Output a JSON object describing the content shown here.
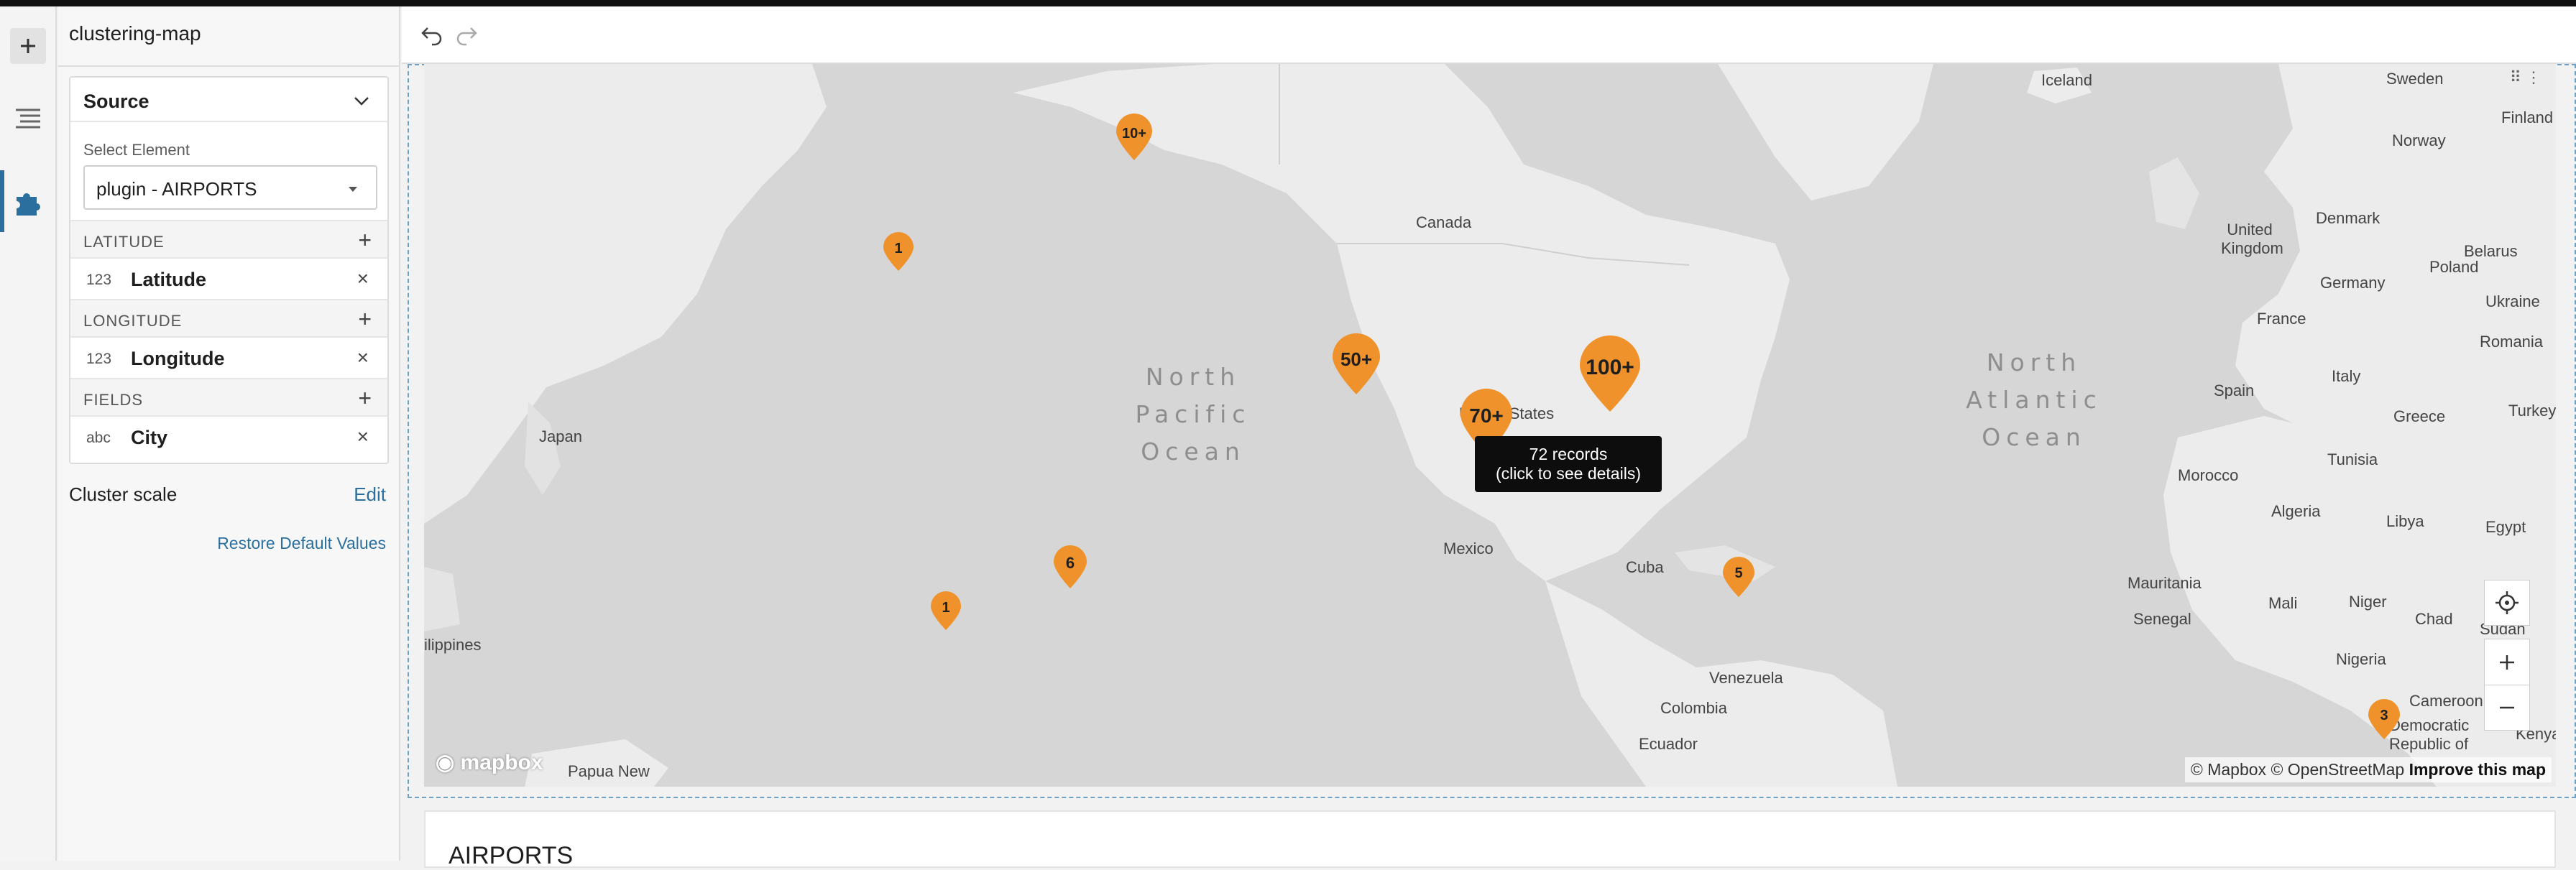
{
  "panel": {
    "title": "clustering-map",
    "source": {
      "title": "Source",
      "select_label": "Select Element",
      "select_value": "plugin - AIRPORTS"
    },
    "sections": [
      {
        "label": "LATITUDE",
        "field": {
          "type": "123",
          "name": "Latitude"
        }
      },
      {
        "label": "LONGITUDE",
        "field": {
          "type": "123",
          "name": "Longitude"
        }
      },
      {
        "label": "FIELDS",
        "field": {
          "type": "abc",
          "name": "City"
        }
      }
    ],
    "cluster_scale_label": "Cluster scale",
    "cluster_scale_edit": "Edit",
    "restore_label": "Restore Default Values"
  },
  "map": {
    "oceans": [
      {
        "text": "North Pacific Ocean"
      },
      {
        "text": "North Atlantic Ocean"
      }
    ],
    "places": [
      "Iceland",
      "Sweden",
      "Finland",
      "Norway",
      "Canada",
      "United Kingdom",
      "Denmark",
      "Belarus",
      "Poland",
      "Germany",
      "Ukraine",
      "France",
      "Romania",
      "Spain",
      "Italy",
      "Greece",
      "Turkey",
      "Japan",
      "United States",
      "Tunisia",
      "Morocco",
      "Algeria",
      "Libya",
      "Egypt",
      "Mexico",
      "Cuba",
      "Mauritania",
      "Mali",
      "Niger",
      "Chad",
      "Sudan",
      "Senegal",
      "Nigeria",
      "Venezuela",
      "Colombia",
      "Ecuador",
      "Cameroon",
      "Democratic Republic of",
      "Kenya",
      "Papua New",
      "ilippines"
    ],
    "clusters": [
      {
        "label": "10+",
        "count_bucket": "10+"
      },
      {
        "label": "1",
        "count_bucket": "1"
      },
      {
        "label": "50+",
        "count_bucket": "50+"
      },
      {
        "label": "100+",
        "count_bucket": "100+"
      },
      {
        "label": "70+",
        "count_bucket": "70+"
      },
      {
        "label": "6",
        "count_bucket": "6"
      },
      {
        "label": "1",
        "count_bucket": "1"
      },
      {
        "label": "5",
        "count_bucket": "5"
      },
      {
        "label": "3",
        "count_bucket": "3"
      }
    ],
    "tooltip": {
      "line1": "72 records",
      "line2": "(click to see details)"
    },
    "logo": "mapbox",
    "attribution": {
      "mapbox": "© Mapbox",
      "osm": "© OpenStreetMap",
      "improve": "Improve this map"
    },
    "pin_color": "#f0922b"
  },
  "table": {
    "title": "AIRPORTS"
  },
  "colors": {
    "accent": "#2b6f9e",
    "pin": "#f0922b",
    "land": "#ececec",
    "water": "#d6d6d6"
  }
}
